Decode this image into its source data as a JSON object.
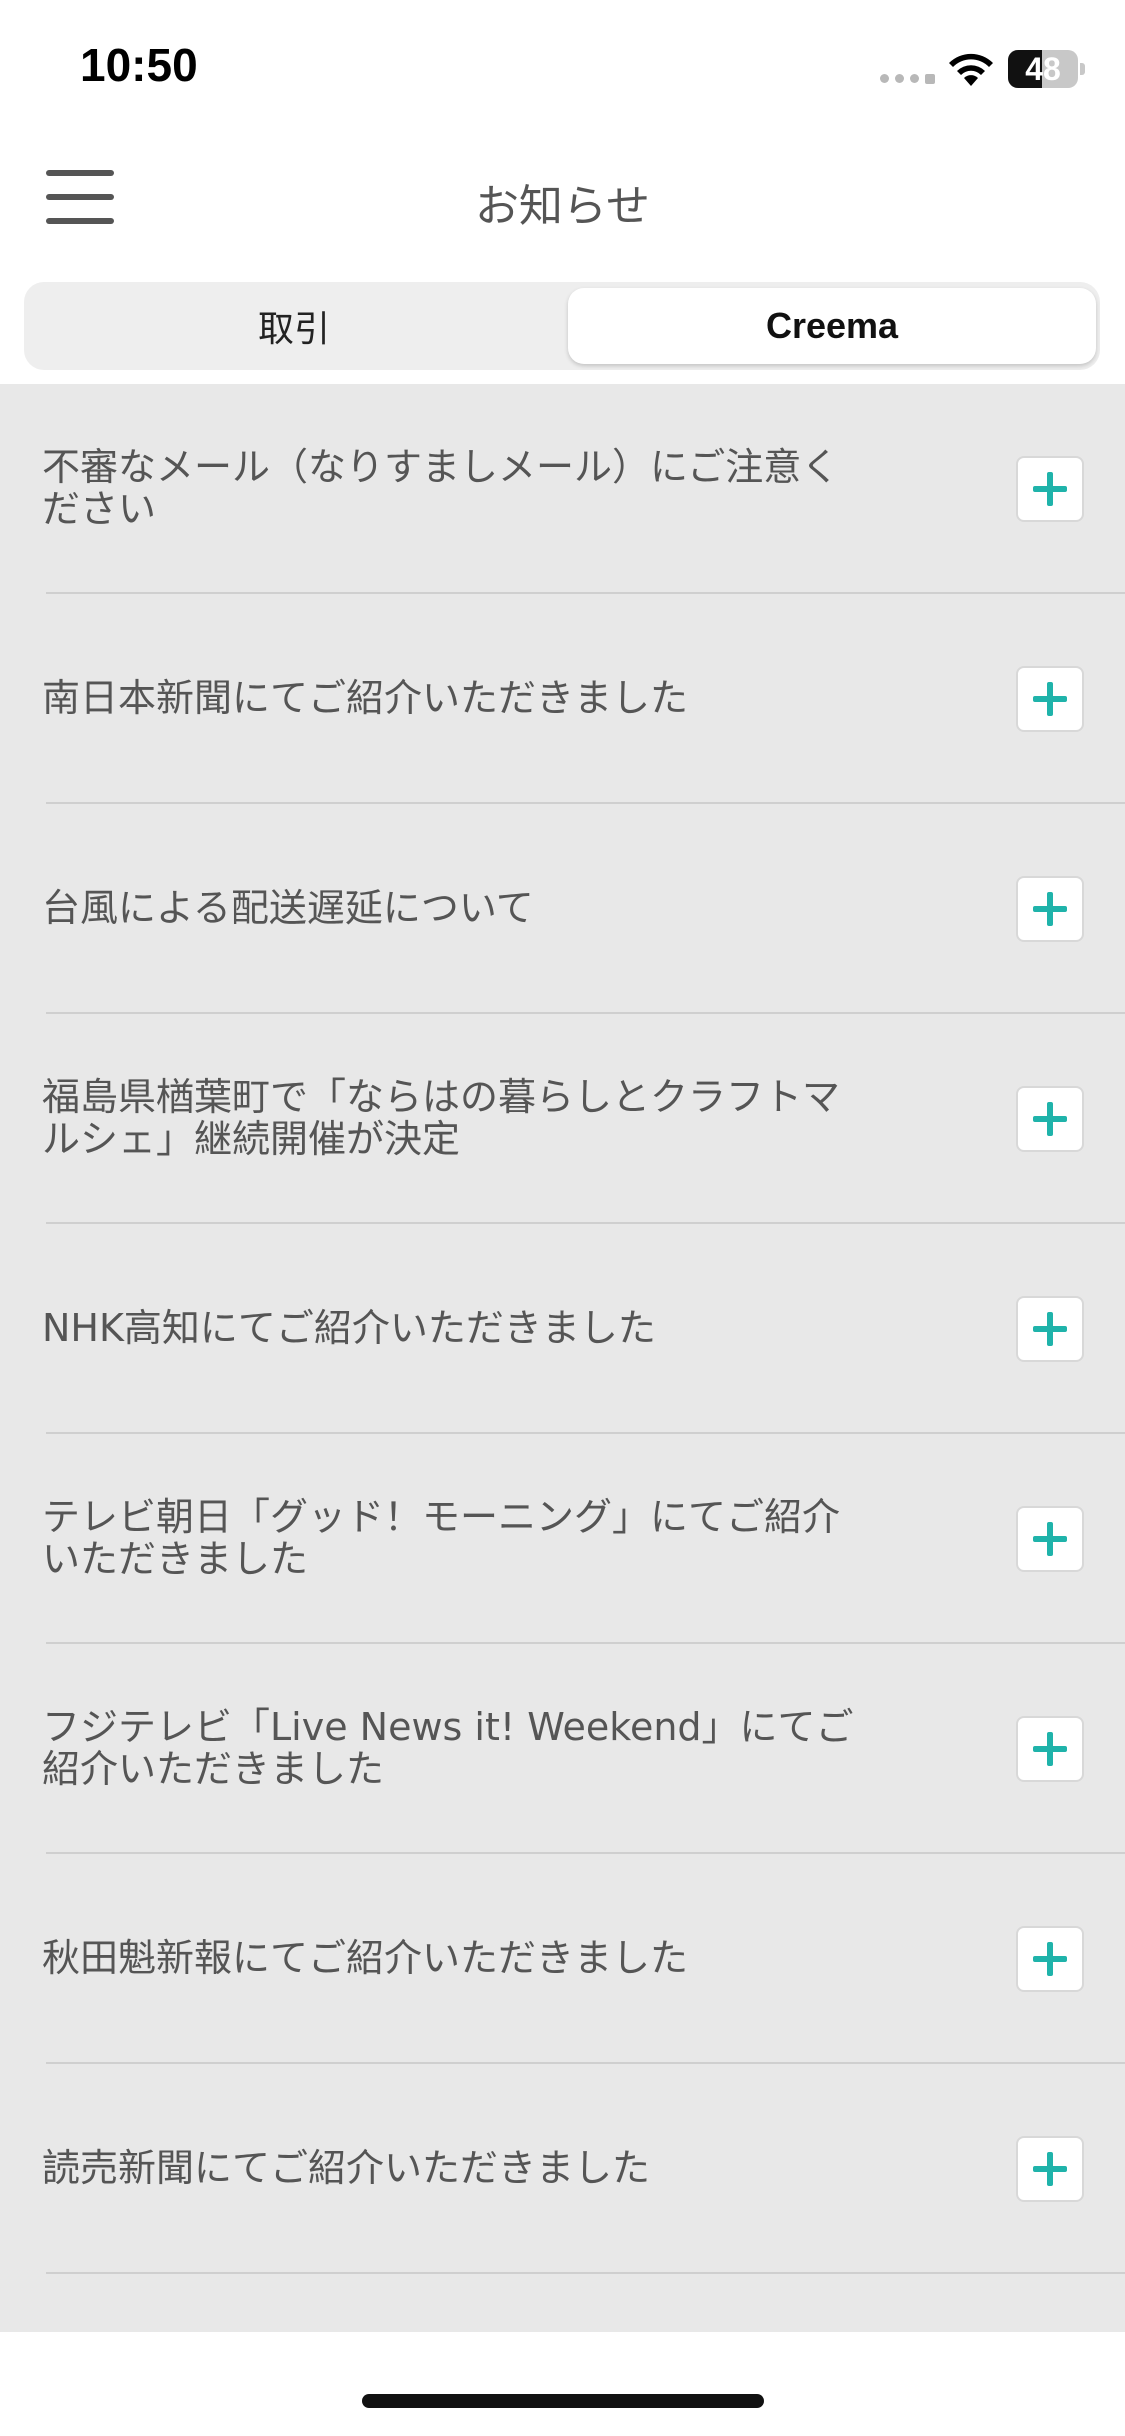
{
  "status_bar": {
    "time": "10:50",
    "battery_level": "48",
    "icons": [
      "signal-icon",
      "wifi-icon",
      "battery-icon"
    ]
  },
  "header": {
    "title": "お知らせ",
    "menu_icon": "hamburger-menu-icon"
  },
  "tabs": [
    {
      "label": "取引",
      "selected": false
    },
    {
      "label": "Creema",
      "selected": true
    }
  ],
  "news_items": [
    {
      "title": "不審なメール（なりすましメール）にご注意く\nださい"
    },
    {
      "title": "南日本新聞にてご紹介いただきました"
    },
    {
      "title": "台風による配送遅延について"
    },
    {
      "title": "福島県楢葉町で「ならはの暮らしとクラフトマ\nルシェ」継続開催が決定"
    },
    {
      "title": "NHK高知にてご紹介いただきました"
    },
    {
      "title": "テレビ朝日「グッド！モーニング」にてご紹介\nいただきました"
    },
    {
      "title": "フジテレビ「Live News it! Weekend」にてご\n紹介いただきました"
    },
    {
      "title": "秋田魁新報にてご紹介いただきました"
    },
    {
      "title": "読売新聞にてご紹介いただきました"
    }
  ],
  "colors": {
    "accent": "#1fb3aa",
    "list_background": "#e8e8e8",
    "divider": "#cfcfcf"
  }
}
